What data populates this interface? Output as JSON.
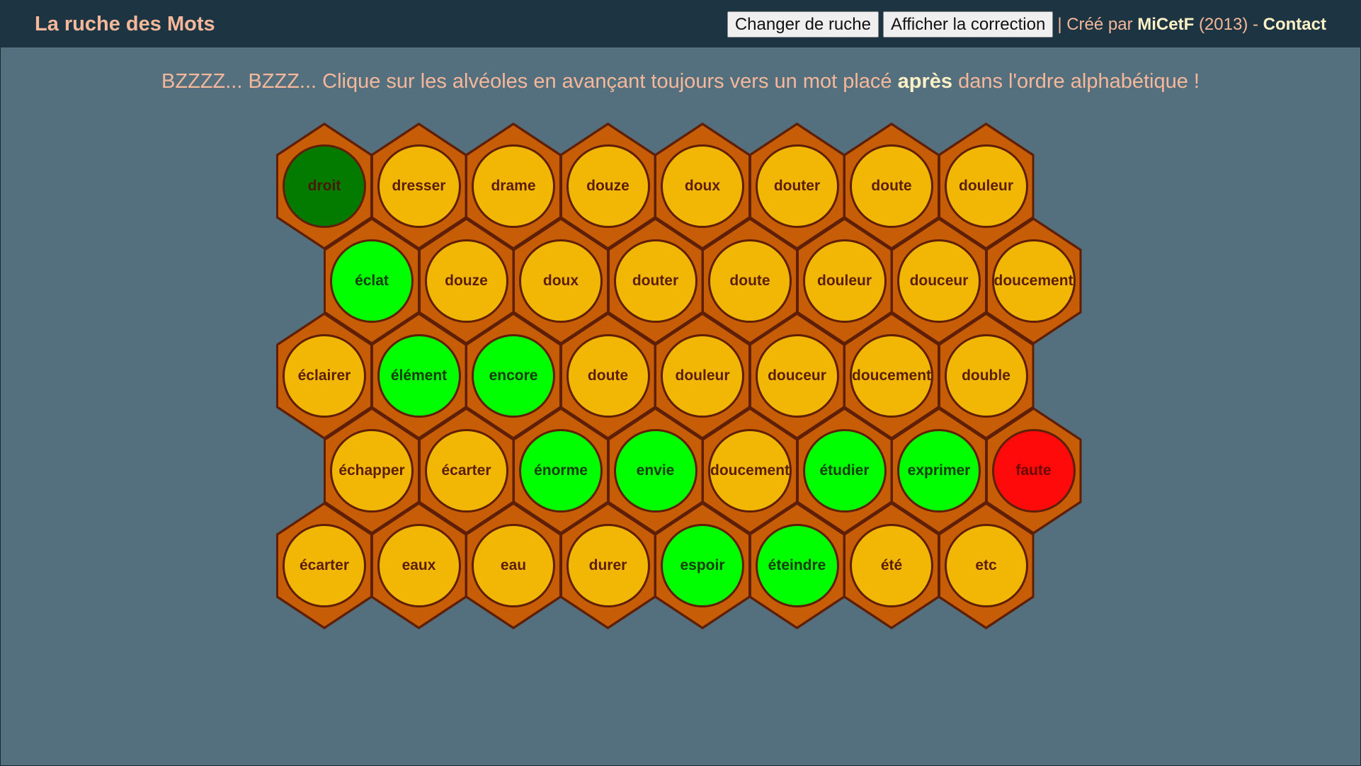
{
  "header": {
    "title": "La ruche des Mots",
    "buttons": {
      "change_hive": "Changer de ruche",
      "show_correction": "Afficher la correction"
    },
    "credit": {
      "separator": "| Créé par",
      "author": "MiCetF",
      "year": "(2013) -",
      "contact": "Contact"
    }
  },
  "instruction": {
    "before": "BZZZZ... BZZZ... Clique sur les alvéoles en avançant toujours vers un mot placé",
    "emphasis": "après",
    "after": "dans l'ordre alphabétique !"
  },
  "colors": {
    "background": "#546f7e",
    "header": "#1d3442",
    "cell": "#c75d06",
    "normal": "#f2b705",
    "start": "#037a00",
    "correct": "#00ff00",
    "wrong": "#ff0a0a"
  },
  "hive": {
    "rows": [
      [
        {
          "word": "droit",
          "state": "start"
        },
        {
          "word": "dresser",
          "state": "normal"
        },
        {
          "word": "drame",
          "state": "normal"
        },
        {
          "word": "douze",
          "state": "normal"
        },
        {
          "word": "doux",
          "state": "normal"
        },
        {
          "word": "douter",
          "state": "normal"
        },
        {
          "word": "doute",
          "state": "normal"
        },
        {
          "word": "douleur",
          "state": "normal"
        }
      ],
      [
        {
          "word": "éclat",
          "state": "correct"
        },
        {
          "word": "douze",
          "state": "normal"
        },
        {
          "word": "doux",
          "state": "normal"
        },
        {
          "word": "douter",
          "state": "normal"
        },
        {
          "word": "doute",
          "state": "normal"
        },
        {
          "word": "douleur",
          "state": "normal"
        },
        {
          "word": "douceur",
          "state": "normal"
        },
        {
          "word": "doucement",
          "state": "normal"
        }
      ],
      [
        {
          "word": "éclairer",
          "state": "normal"
        },
        {
          "word": "élément",
          "state": "correct"
        },
        {
          "word": "encore",
          "state": "correct"
        },
        {
          "word": "doute",
          "state": "normal"
        },
        {
          "word": "douleur",
          "state": "normal"
        },
        {
          "word": "douceur",
          "state": "normal"
        },
        {
          "word": "doucement",
          "state": "normal"
        },
        {
          "word": "double",
          "state": "normal"
        }
      ],
      [
        {
          "word": "échapper",
          "state": "normal"
        },
        {
          "word": "écarter",
          "state": "normal"
        },
        {
          "word": "énorme",
          "state": "correct"
        },
        {
          "word": "envie",
          "state": "correct"
        },
        {
          "word": "doucement",
          "state": "normal"
        },
        {
          "word": "étudier",
          "state": "correct"
        },
        {
          "word": "exprimer",
          "state": "correct"
        },
        {
          "word": "faute",
          "state": "wrong"
        }
      ],
      [
        {
          "word": "écarter",
          "state": "normal"
        },
        {
          "word": "eaux",
          "state": "normal"
        },
        {
          "word": "eau",
          "state": "normal"
        },
        {
          "word": "durer",
          "state": "normal"
        },
        {
          "word": "espoir",
          "state": "correct"
        },
        {
          "word": "éteindre",
          "state": "correct"
        },
        {
          "word": "été",
          "state": "normal"
        },
        {
          "word": "etc",
          "state": "normal"
        }
      ]
    ]
  }
}
